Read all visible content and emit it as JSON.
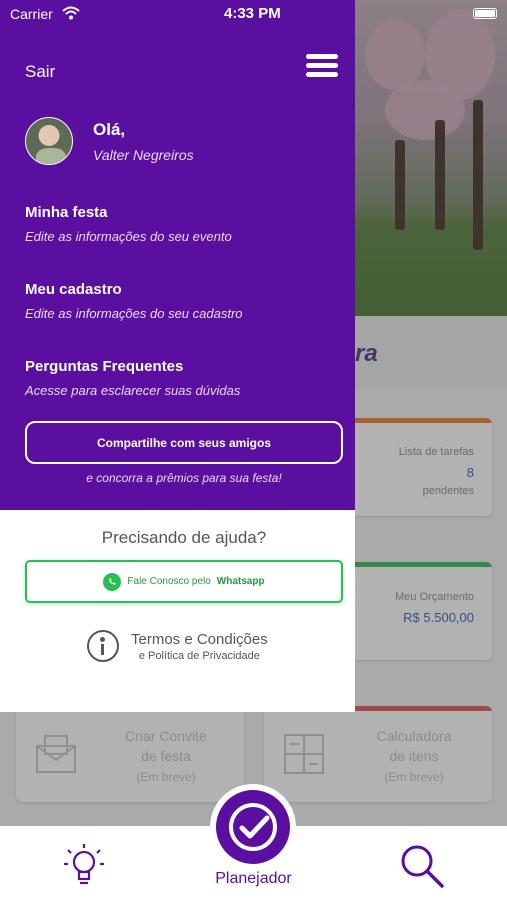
{
  "status_bar": {
    "carrier": "Carrier",
    "time": "4:33 PM"
  },
  "drawer": {
    "exit_label": "Sair",
    "greeting": "Olá,",
    "user_name": "Valter Negreiros",
    "menu": [
      {
        "title": "Minha festa",
        "subtitle": "Edite as informações do seu evento"
      },
      {
        "title": "Meu cadastro",
        "subtitle": "Edite as informações do seu cadastro"
      },
      {
        "title": "Perguntas Frequentes",
        "subtitle": "Acesse para esclarecer suas dúvidas"
      }
    ],
    "share_button": "Compartilhe com seus amigos",
    "share_note": "e concorra a prêmios para sua festa!",
    "help_title": "Precisando de ajuda?",
    "whatsapp_prefix": "Fale Conosco pelo",
    "whatsapp_label": "Whatsapp",
    "terms_title": "Termos e Condições",
    "terms_subtitle": "e Política de Privacidade"
  },
  "background": {
    "title_fragment": "ra",
    "card_tasks": {
      "label": "Lista de tarefas",
      "value": "8",
      "unit": "pendentes"
    },
    "card_budget": {
      "label": "Meu Orçamento",
      "value": "R$ 5.500,00"
    },
    "card_invite": {
      "title_line1": "Criar Convite",
      "title_line2": "de festa",
      "note": "(Em breve)"
    },
    "card_calc": {
      "title_line1": "Calculadora",
      "title_line2": "de itens",
      "note": "(Em breve)"
    }
  },
  "tabbar": {
    "center_label": "Planejador"
  },
  "colors": {
    "brand_purple": "#5a0fa0",
    "whatsapp_green": "#25c04f",
    "accent_blue": "#4a73c7"
  }
}
